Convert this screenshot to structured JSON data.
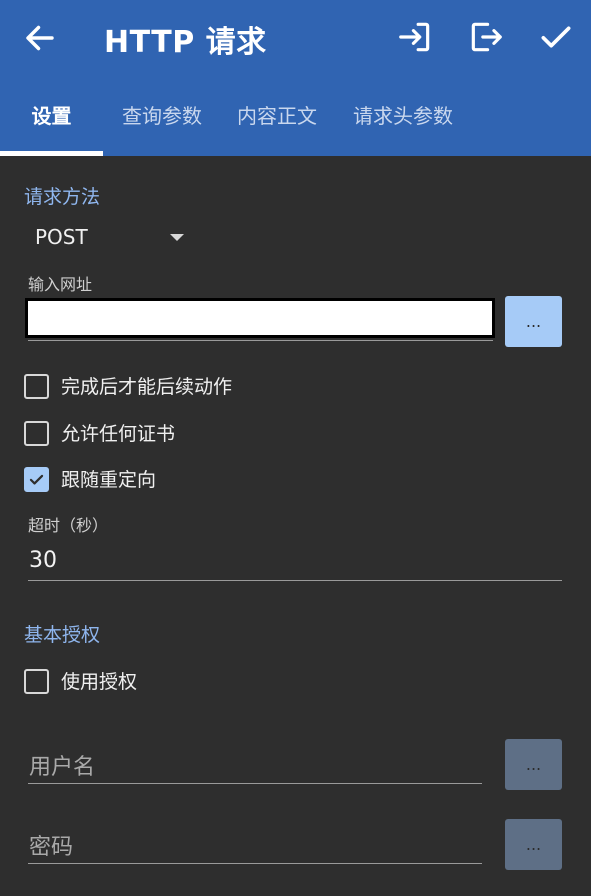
{
  "header": {
    "title": "HTTP 请求",
    "back_icon": "arrow-left-icon",
    "actions": [
      "import-icon",
      "export-icon",
      "check-icon"
    ]
  },
  "tabs": [
    {
      "label": "设置",
      "active": true
    },
    {
      "label": "查询参数",
      "active": false
    },
    {
      "label": "内容正文",
      "active": false
    },
    {
      "label": "请求头参数",
      "active": false
    }
  ],
  "request": {
    "section_title": "请求方法",
    "method": "POST",
    "url_label": "输入网址",
    "url_value": "",
    "url_button": "...",
    "options": [
      {
        "label": "完成后才能后续动作",
        "checked": false
      },
      {
        "label": "允许任何证书",
        "checked": false
      },
      {
        "label": "跟随重定向",
        "checked": true
      }
    ],
    "timeout_label": "超时（秒）",
    "timeout_value": "30"
  },
  "auth": {
    "section_title": "基本授权",
    "use_auth": {
      "label": "使用授权",
      "checked": false
    },
    "username_placeholder": "用户名",
    "username_button": "...",
    "password_placeholder": "密码",
    "password_button": "..."
  },
  "colors": {
    "appbar": "#3064b2",
    "background": "#2e2e2e",
    "accent": "#a6cbf7",
    "section_title": "#8fb6ee"
  }
}
